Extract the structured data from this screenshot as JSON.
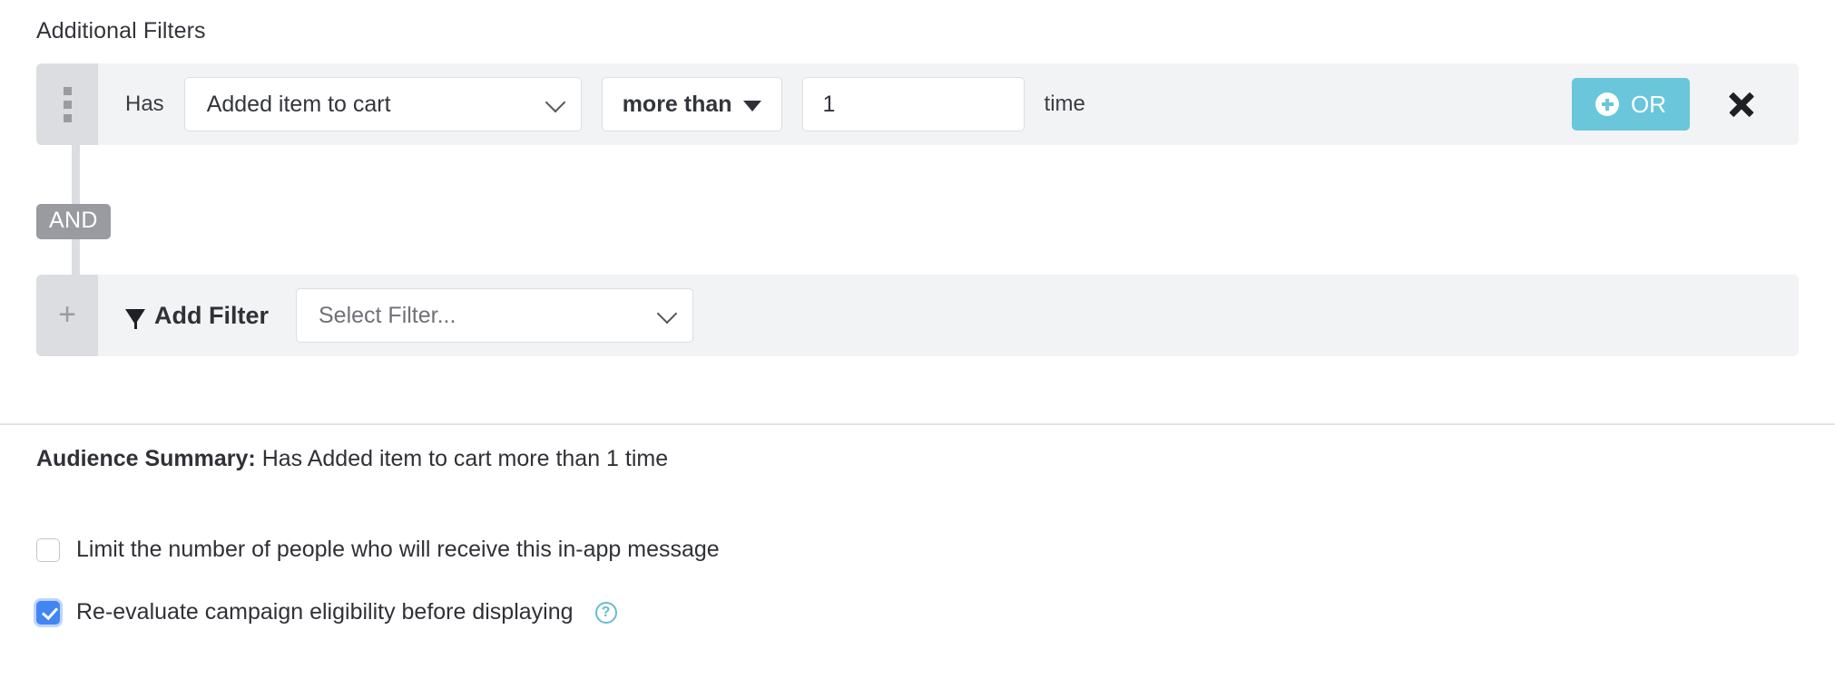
{
  "section": {
    "title": "Additional Filters"
  },
  "filter_row": {
    "grip_icon": "drag-handle-icon",
    "prefix_label": "Has",
    "event_select": {
      "value": "Added item to cart",
      "chevron_icon": "chevron-down-icon"
    },
    "comparator_select": {
      "value": "more than",
      "caret_icon": "caret-down-icon"
    },
    "count_input": {
      "value": "1"
    },
    "unit_label": "time",
    "or_button": {
      "label": "OR",
      "icon": "plus-circle-icon",
      "color": "#6ac6da"
    },
    "remove_icon": "close-x-icon"
  },
  "connector": {
    "operator_label": "AND",
    "color": "#9a9ba0"
  },
  "add_filter_row": {
    "grip_icon": "plus-icon",
    "funnel_icon": "filter-funnel-icon",
    "label": "Add Filter",
    "select": {
      "placeholder": "Select Filter...",
      "chevron_icon": "chevron-down-icon"
    }
  },
  "summary": {
    "label": "Audience Summary:",
    "text": " Has Added item to cart more than 1 time"
  },
  "options": {
    "limit": {
      "label": "Limit the number of people who will receive this in-app message",
      "checked": false
    },
    "reevaluate": {
      "label": "Re-evaluate campaign eligibility before displaying",
      "checked": true,
      "help_icon": "question-mark-icon",
      "help_glyph": "?"
    }
  },
  "colors": {
    "row_background": "#f2f3f5",
    "grip_background": "#dcdde1",
    "accent_teal": "#6ac6da",
    "checkbox_blue": "#4285f4"
  }
}
